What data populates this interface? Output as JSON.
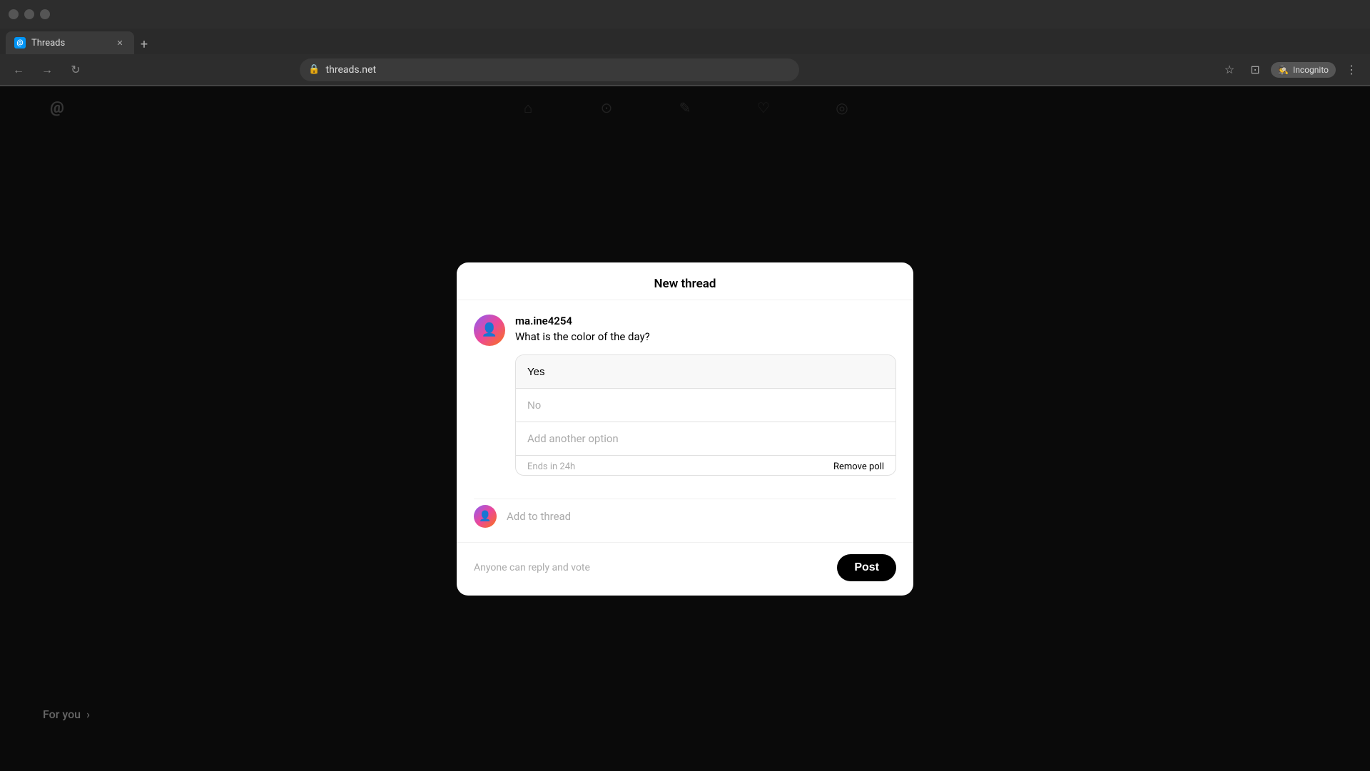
{
  "browser": {
    "tab_title": "Threads",
    "favicon_letter": "@",
    "url": "threads.net",
    "new_tab_symbol": "+",
    "nav": {
      "back": "←",
      "forward": "→",
      "refresh": "↻",
      "bookmark": "☆",
      "profile": "⊡",
      "incognito_label": "Incognito",
      "more": "⋮"
    }
  },
  "modal": {
    "title": "New thread",
    "username": "ma.ine4254",
    "thread_text": "What is the color of the day?",
    "poll": {
      "option1_value": "Yes",
      "option1_placeholder": "Yes",
      "option2_placeholder": "No",
      "add_option_label": "Add another option",
      "ends_label": "Ends in 24h",
      "remove_poll_label": "Remove poll"
    },
    "add_thread_placeholder": "Add to thread",
    "footer_note": "Anyone can reply and vote",
    "post_button_label": "Post"
  },
  "background": {
    "for_you_label": "For you",
    "for_you_arrow": "›"
  }
}
